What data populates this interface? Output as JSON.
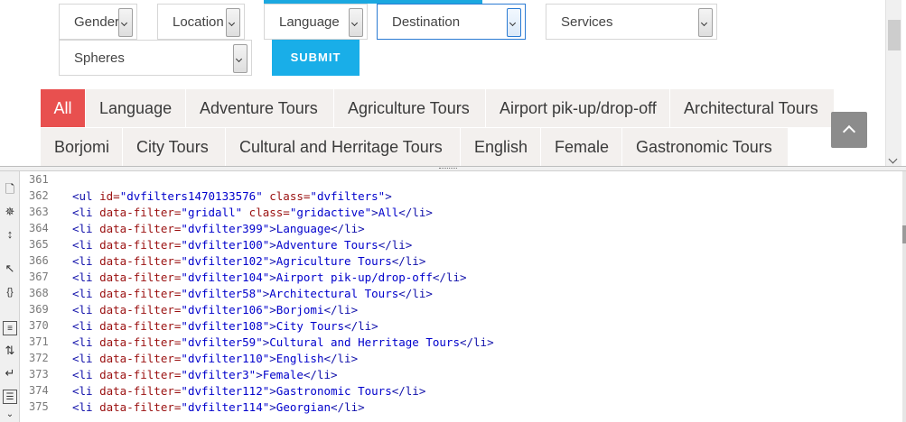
{
  "filters": {
    "gender": "Gender",
    "location": "Location",
    "language": "Language",
    "destination": "Destination",
    "services": "Services",
    "spheres": "Spheres",
    "submit": "SUBMIT"
  },
  "tabs_row1": [
    "All",
    "Language",
    "Adventure Tours",
    "Agriculture Tours",
    "Airport pik-up/drop-off",
    "Architectural Tours"
  ],
  "tabs_row2": [
    "Borjomi",
    "City Tours",
    "Cultural and Herritage Tours",
    "English",
    "Female",
    "Gastronomic Tours"
  ],
  "active_tab": "All",
  "colors": {
    "accent": "#1ba8e0",
    "active_tab": "#e8504f",
    "tab_bg": "#f3f0ee"
  },
  "source": {
    "lines": [
      {
        "num": "361",
        "tag": "",
        "attrs": [],
        "text": ""
      },
      {
        "num": "362",
        "tag": "ul",
        "attrs": [
          [
            "id",
            "dvfilters1470133576"
          ],
          [
            "class",
            "dvfilters"
          ]
        ],
        "text": null
      },
      {
        "num": "363",
        "tag": "li",
        "attrs": [
          [
            "data-filter",
            "gridall"
          ],
          [
            "class",
            "gridactive"
          ]
        ],
        "text": "All"
      },
      {
        "num": "364",
        "tag": "li",
        "attrs": [
          [
            "data-filter",
            "dvfilter399"
          ]
        ],
        "text": "Language"
      },
      {
        "num": "365",
        "tag": "li",
        "attrs": [
          [
            "data-filter",
            "dvfilter100"
          ]
        ],
        "text": "Adventure Tours"
      },
      {
        "num": "366",
        "tag": "li",
        "attrs": [
          [
            "data-filter",
            "dvfilter102"
          ]
        ],
        "text": "Agriculture Tours"
      },
      {
        "num": "367",
        "tag": "li",
        "attrs": [
          [
            "data-filter",
            "dvfilter104"
          ]
        ],
        "text": "Airport pik-up/drop-off"
      },
      {
        "num": "368",
        "tag": "li",
        "attrs": [
          [
            "data-filter",
            "dvfilter58"
          ]
        ],
        "text": "Architectural Tours"
      },
      {
        "num": "369",
        "tag": "li",
        "attrs": [
          [
            "data-filter",
            "dvfilter106"
          ]
        ],
        "text": "Borjomi"
      },
      {
        "num": "370",
        "tag": "li",
        "attrs": [
          [
            "data-filter",
            "dvfilter108"
          ]
        ],
        "text": "City Tours"
      },
      {
        "num": "371",
        "tag": "li",
        "attrs": [
          [
            "data-filter",
            "dvfilter59"
          ]
        ],
        "text": "Cultural and Herritage Tours"
      },
      {
        "num": "372",
        "tag": "li",
        "attrs": [
          [
            "data-filter",
            "dvfilter110"
          ]
        ],
        "text": "English"
      },
      {
        "num": "373",
        "tag": "li",
        "attrs": [
          [
            "data-filter",
            "dvfilter3"
          ]
        ],
        "text": "Female"
      },
      {
        "num": "374",
        "tag": "li",
        "attrs": [
          [
            "data-filter",
            "dvfilter112"
          ]
        ],
        "text": "Gastronomic Tours"
      },
      {
        "num": "375",
        "tag": "li",
        "attrs": [
          [
            "data-filter",
            "dvfilter114"
          ]
        ],
        "text": "Georgian"
      }
    ]
  },
  "toolbar_icons": [
    "document-icon",
    "crosshair-icon",
    "collapse-icon",
    "pointer-icon",
    "brackets-icon",
    "line-numbers-icon",
    "sort-icon",
    "wrap-icon",
    "view-source-icon",
    "chevron-down-icon"
  ]
}
